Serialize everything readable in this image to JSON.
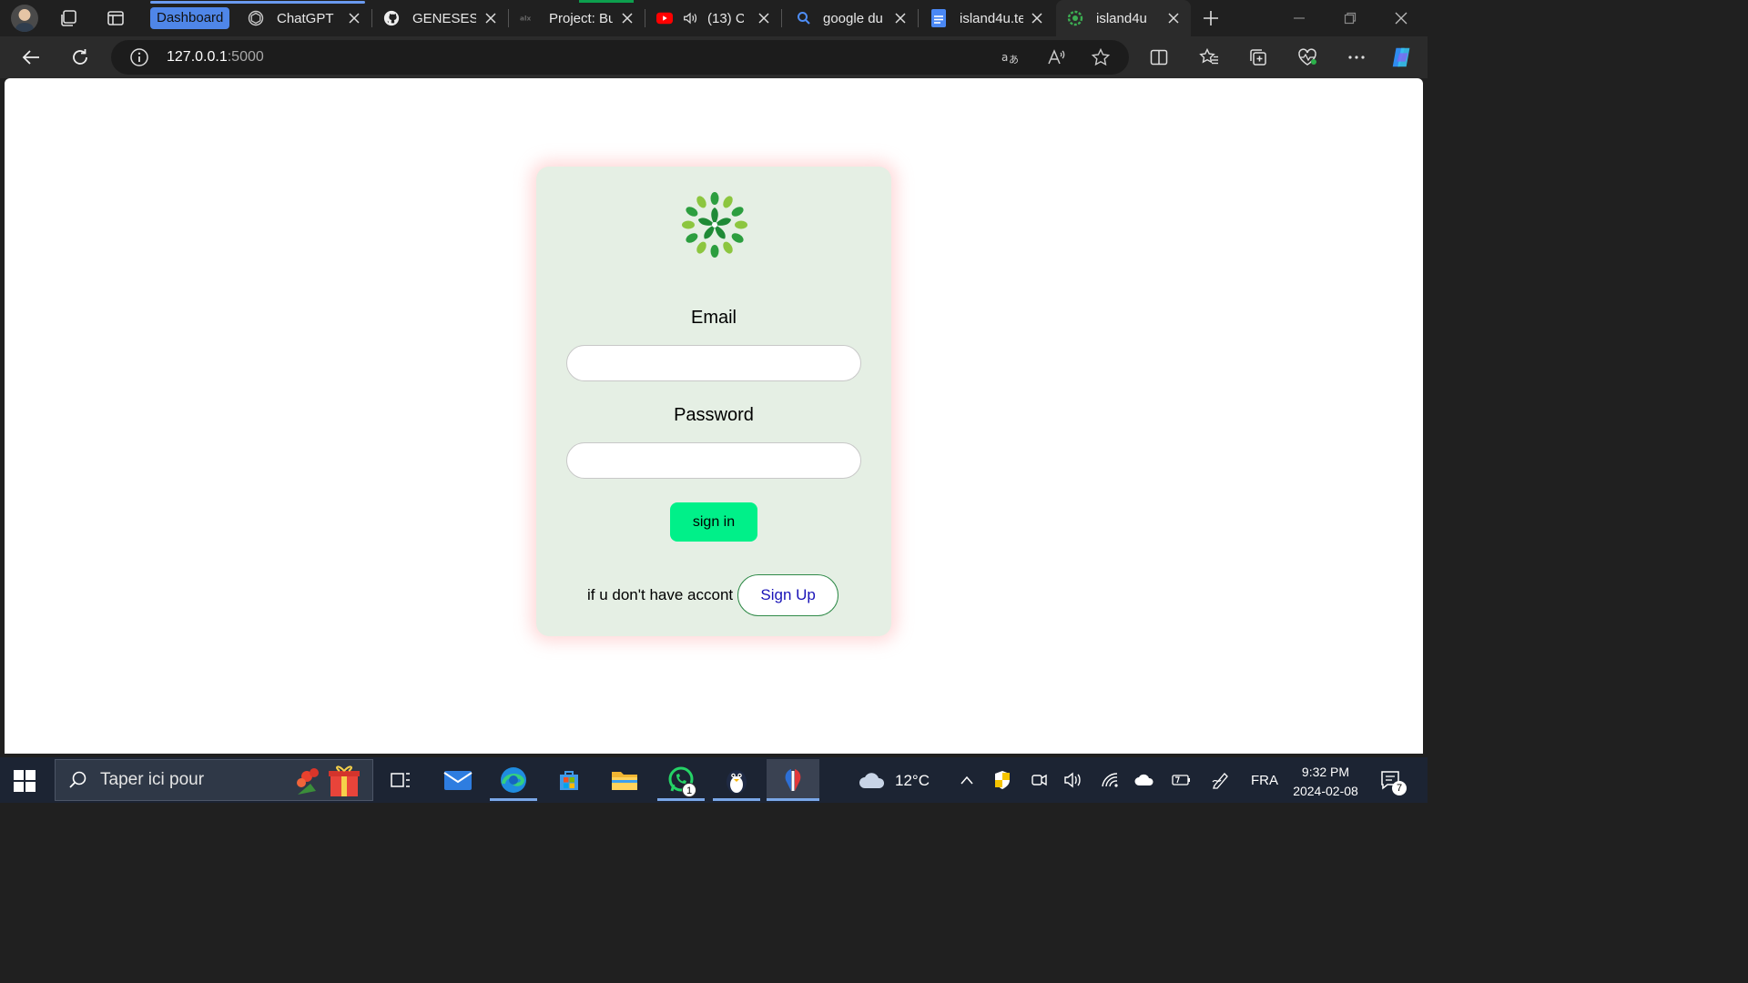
{
  "browser": {
    "tab_group_label": "Dashboard",
    "tabs": [
      {
        "title": "ChatGPT",
        "icon": "chatgpt-icon"
      },
      {
        "title": "GENESESH",
        "icon": "github-icon"
      },
      {
        "title": "Project: Bu",
        "icon": "alx-icon"
      },
      {
        "title": "(13) C",
        "icon": "youtube-icon"
      },
      {
        "title": "google du",
        "icon": "search-icon"
      },
      {
        "title": "island4u.te",
        "icon": "docs-icon"
      },
      {
        "title": "island4u",
        "icon": "island4u-logo-icon"
      }
    ],
    "active_tab_index": 6,
    "address": {
      "host": "127.0.0.1",
      "port": ":5000"
    }
  },
  "login": {
    "email_label": "Email",
    "email_value": "",
    "password_label": "Password",
    "password_value": "",
    "signin_label": "sign in",
    "signup_prompt": "if u don't have accont",
    "signup_label": "Sign Up"
  },
  "colors": {
    "card_background": "#e5efe4",
    "signin_button": "#00f089",
    "signup_text": "#1a14b8",
    "logo_green": "#2c9e3f"
  },
  "taskbar": {
    "search_placeholder": "Taper ici pour",
    "whatsapp_badge": "1",
    "weather_temp": "12°C",
    "language": "FRA",
    "time": "9:32 PM",
    "date": "2024-02-08",
    "notification_count": "7"
  }
}
